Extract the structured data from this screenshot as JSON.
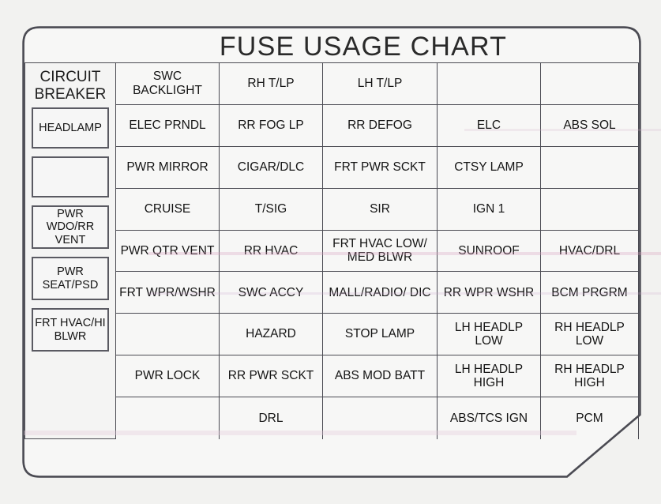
{
  "title": "FUSE USAGE CHART",
  "breaker": {
    "heading_line1": "CIRCUIT",
    "heading_line2": "BREAKER",
    "slots": [
      {
        "label": "HEADLAMP"
      },
      {
        "label": ""
      },
      {
        "label": "PWR WDO/RR VENT"
      },
      {
        "label": "PWR SEAT/PSD"
      },
      {
        "label": "FRT HVAC/HI BLWR"
      }
    ]
  },
  "grid": {
    "columns": 5,
    "rows": 9,
    "cells": [
      [
        "SWC BACKLIGHT",
        "RH T/LP",
        "LH T/LP",
        "",
        ""
      ],
      [
        "ELEC PRNDL",
        "RR FOG LP",
        "RR DEFOG",
        "ELC",
        "ABS SOL"
      ],
      [
        "PWR MIRROR",
        "CIGAR/DLC",
        "FRT PWR SCKT",
        "CTSY LAMP",
        ""
      ],
      [
        "CRUISE",
        "T/SIG",
        "SIR",
        "IGN 1",
        ""
      ],
      [
        "PWR QTR VENT",
        "RR HVAC",
        "FRT HVAC LOW/ MED BLWR",
        "SUNROOF",
        "HVAC/DRL"
      ],
      [
        "FRT WPR/WSHR",
        "SWC ACCY",
        "MALL/RADIO/ DIC",
        "RR WPR WSHR",
        "BCM PRGRM"
      ],
      [
        "",
        "HAZARD",
        "STOP LAMP",
        "LH HEADLP LOW",
        "RH HEADLP LOW"
      ],
      [
        "PWR LOCK",
        "RR PWR SCKT",
        "ABS MOD BATT",
        "LH HEADLP HIGH",
        "RH HEADLP HIGH"
      ],
      [
        "",
        "DRL",
        "",
        "ABS/TCS IGN",
        "PCM"
      ]
    ]
  },
  "colors": {
    "background": "#f2f2f0",
    "decal_fill": "#f7f7f6",
    "line": "#4b4b53",
    "text": "#141414",
    "title_text": "#2a2a2a"
  }
}
